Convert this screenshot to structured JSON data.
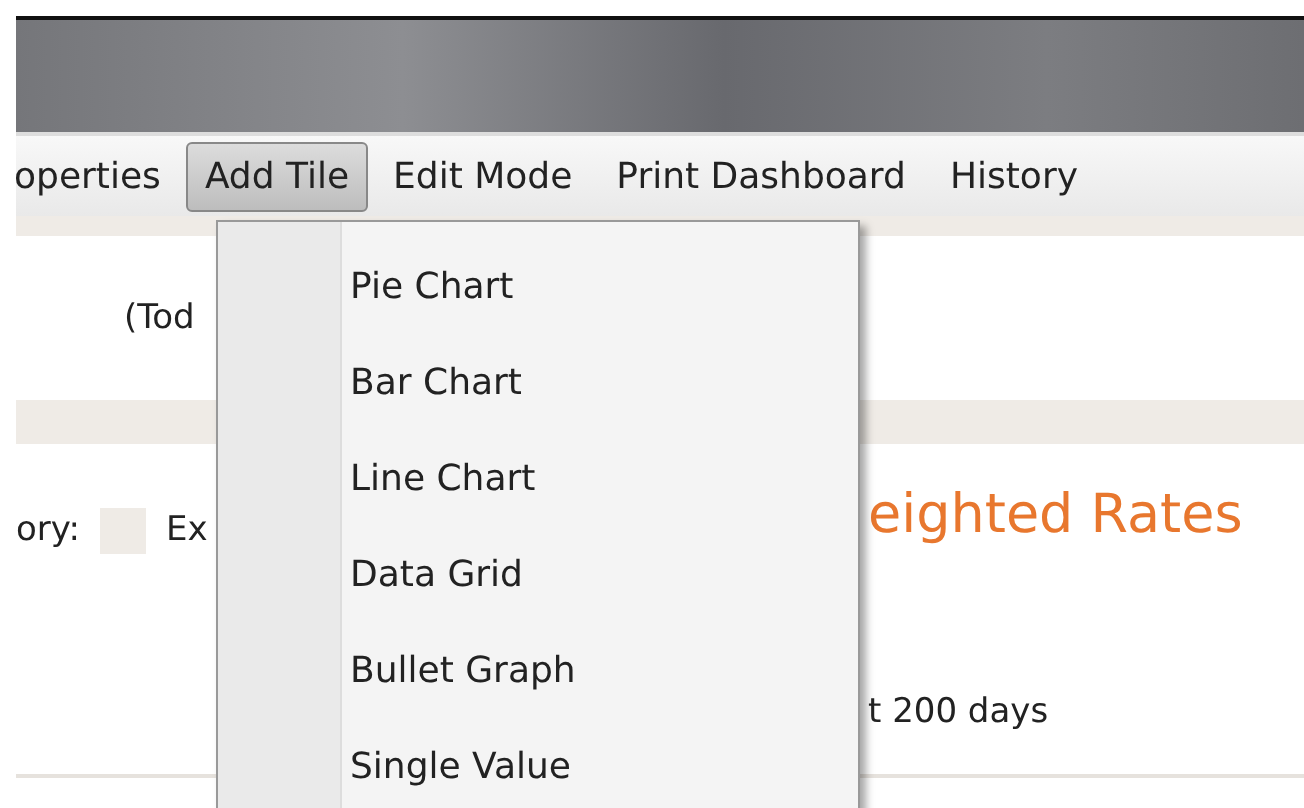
{
  "menu_bar": [
    {
      "label": "operties",
      "selected": false
    },
    {
      "label": "Add Tile",
      "selected": true
    },
    {
      "label": "Edit Mode",
      "selected": false
    },
    {
      "label": "Print Dashboard",
      "selected": false
    },
    {
      "label": "History",
      "selected": false
    }
  ],
  "dropdown": [
    "Pie Chart",
    "Bar Chart",
    "Line Chart",
    "Data Grid",
    "Bullet Graph",
    "Single Value"
  ],
  "content": {
    "date_text": "(Tod",
    "legend_label": "ory:",
    "legend_item": "Ex",
    "tile_title": "eighted Rates",
    "tile_subtitle": "t 200 days"
  }
}
